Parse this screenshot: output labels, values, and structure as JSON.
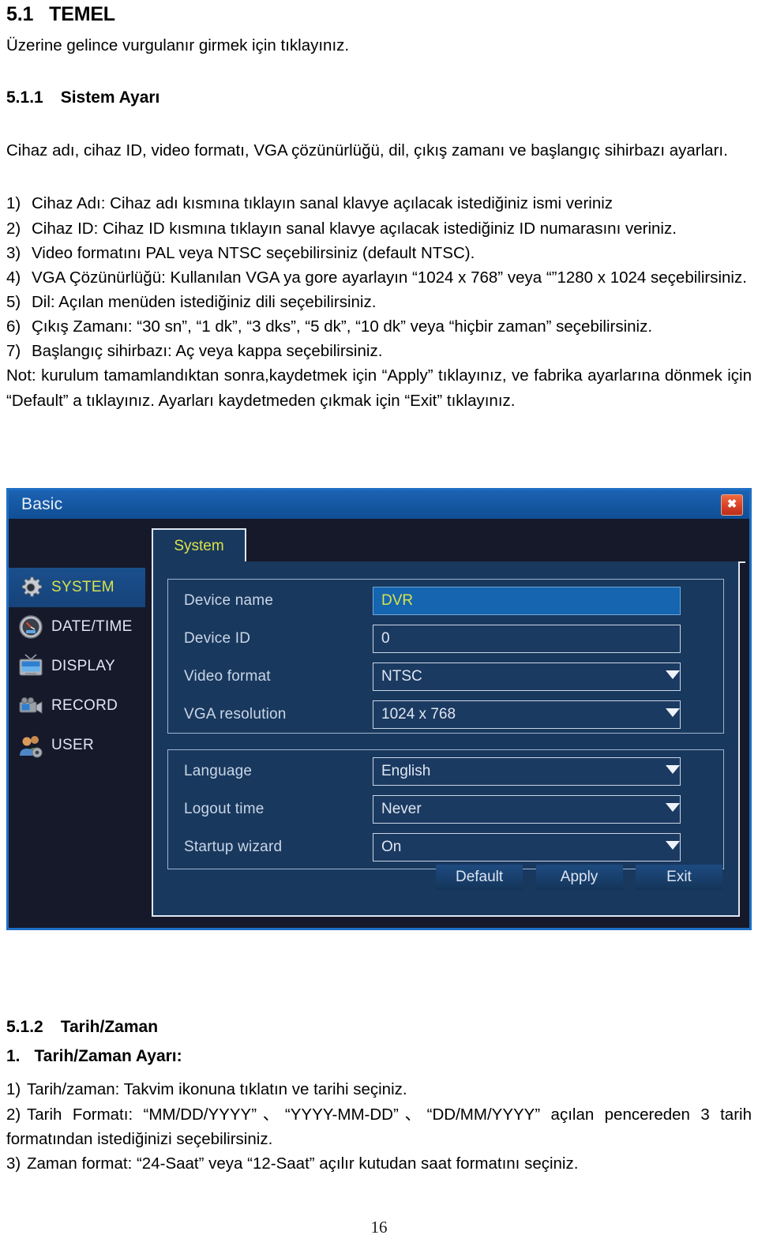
{
  "document": {
    "section": {
      "number": "5.1",
      "title": "TEMEL"
    },
    "lead": "Üzerine gelince vurgulanır girmek için tıklayınız.",
    "subsection": {
      "number": "5.1.1",
      "title": "Sistem Ayarı"
    },
    "intro": "Cihaz adı, cihaz ID, video formatı, VGA çözünürlüğü, dil, çıkış zamanı ve başlangıç sihirbazı ayarları.",
    "steps": [
      {
        "marker": "1)",
        "text": "Cihaz Adı: Cihaz adı kısmına tıklayın sanal klavye açılacak istediğiniz ismi veriniz"
      },
      {
        "marker": "2)",
        "text": "Cihaz ID: Cihaz ID kısmına tıklayın sanal klavye açılacak istediğiniz ID numarasını veriniz."
      },
      {
        "marker": "3)",
        "text": "Video formatını PAL veya NTSC seçebilirsiniz (default NTSC)."
      },
      {
        "marker": "4)",
        "text": "VGA Çözünürlüğü: Kullanılan VGA    ya gore ayarlayın “1024 x 768” veya “”1280 x 1024 seçebilirsiniz."
      },
      {
        "marker": "5)",
        "text": "Dil: Açılan menüden istediğiniz dili seçebilirsiniz."
      },
      {
        "marker": "6)",
        "text": "Çıkış Zamanı: “30 sn”, “1 dk”, “3 dks”, “5 dk”, “10 dk” veya “hiçbir zaman” seçebilirsiniz."
      },
      {
        "marker": "7)",
        "text": "Başlangıç        sihirbazı: Aç veya kappa seçebilirsiniz."
      }
    ],
    "note": "Not: kurulum tamamlandıktan sonra,kaydetmek için “Apply” tıklayınız, ve fabrika ayarlarına dönmek için “Default” a tıklayınız. Ayarları kaydetmeden çıkmak için “Exit” tıklayınız.",
    "section2": {
      "number": "5.1.2",
      "title": "Tarih/Zaman"
    },
    "subheading2": {
      "number": "1.",
      "title": "Tarih/Zaman Ayarı:"
    },
    "steps2": [
      {
        "marker": "1)",
        "text": "Tarih/zaman: Takvim ikonuna tıklatın ve tarihi seçiniz."
      },
      {
        "marker": "2)",
        "text": "Tarih Formatı: “MM/DD/YYYY”、“YYYY-MM-DD”、“DD/MM/YYYY” açılan pencereden 3 tarih formatından istediğinizi seçebilirsiniz."
      },
      {
        "marker": "3)",
        "text": "Zaman format: “24-Saat” veya “12-Saat” açılır kutudan saat formatını seçiniz."
      }
    ],
    "page_number": "16"
  },
  "dvr": {
    "window_title": "Basic",
    "close_label": "✖",
    "tab": {
      "label": "System"
    },
    "sidebar": [
      {
        "label": "SYSTEM",
        "icon": "gear-icon",
        "active": true
      },
      {
        "label": "DATE/TIME",
        "icon": "clock-icon",
        "active": false
      },
      {
        "label": "DISPLAY",
        "icon": "monitor-icon",
        "active": false
      },
      {
        "label": "RECORD",
        "icon": "camcorder-icon",
        "active": false
      },
      {
        "label": "USER",
        "icon": "users-icon",
        "active": false
      }
    ],
    "group_a": [
      {
        "label": "Device name",
        "value": "DVR",
        "type": "text",
        "highlight": true
      },
      {
        "label": "Device ID",
        "value": "0",
        "type": "text",
        "highlight": false
      },
      {
        "label": "Video format",
        "value": "NTSC",
        "type": "select",
        "highlight": false
      },
      {
        "label": "VGA resolution",
        "value": "1024 x 768",
        "type": "select",
        "highlight": false
      }
    ],
    "group_b": [
      {
        "label": "Language",
        "value": "English",
        "type": "select",
        "highlight": false
      },
      {
        "label": "Logout time",
        "value": "Never",
        "type": "select",
        "highlight": false
      },
      {
        "label": "Startup wizard",
        "value": "On",
        "type": "select",
        "highlight": false
      }
    ],
    "buttons": [
      {
        "label": "Default"
      },
      {
        "label": "Apply"
      },
      {
        "label": "Exit"
      }
    ],
    "colors": {
      "titlebar": "#14569f",
      "window_bg": "#15192a",
      "panel": "#19385e",
      "accent_border": "#1f6fc4",
      "tab_text": "#d9e24a",
      "highlight_field": "#1565b0",
      "close_button": "#d94126"
    }
  }
}
